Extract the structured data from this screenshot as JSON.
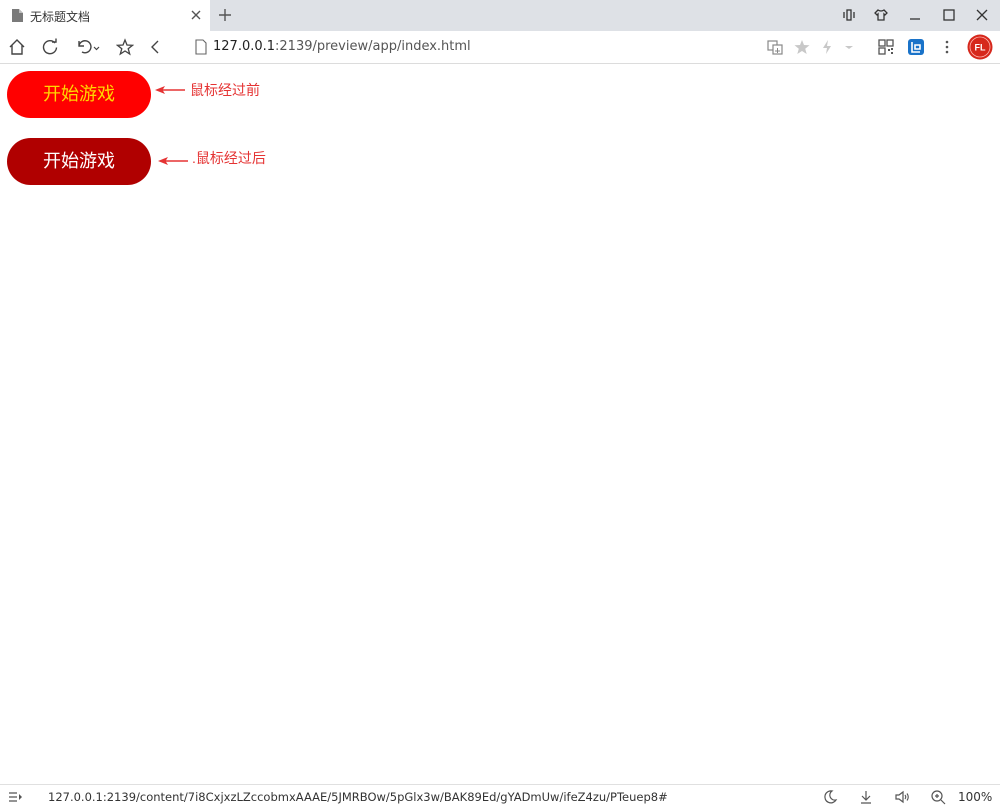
{
  "browser": {
    "tab": {
      "title": "无标题文档"
    },
    "address": {
      "host": "127.0.0.1",
      "rest": ":2139/preview/app/index.html"
    },
    "profile_avatar_text": "FL",
    "status": {
      "url": "127.0.0.1:2139/content/7i8CxjxzLZccobmxAAAE/5JMRBOw/5pGlx3w/BAK89Ed/gYADmUw/ifeZ4zu/PTeuep8#",
      "zoom": "100%"
    }
  },
  "page": {
    "button_before_label": "开始游戏",
    "button_after_label": "开始游戏",
    "annotation_before": "鼠标经过前",
    "annotation_after": ".鼠标经过后"
  },
  "colors": {
    "button_before_bg": "#ff0000",
    "button_before_text": "#ffd700",
    "button_after_bg": "#b00000",
    "button_after_text": "#ffffff",
    "annotation": "#e53333"
  }
}
